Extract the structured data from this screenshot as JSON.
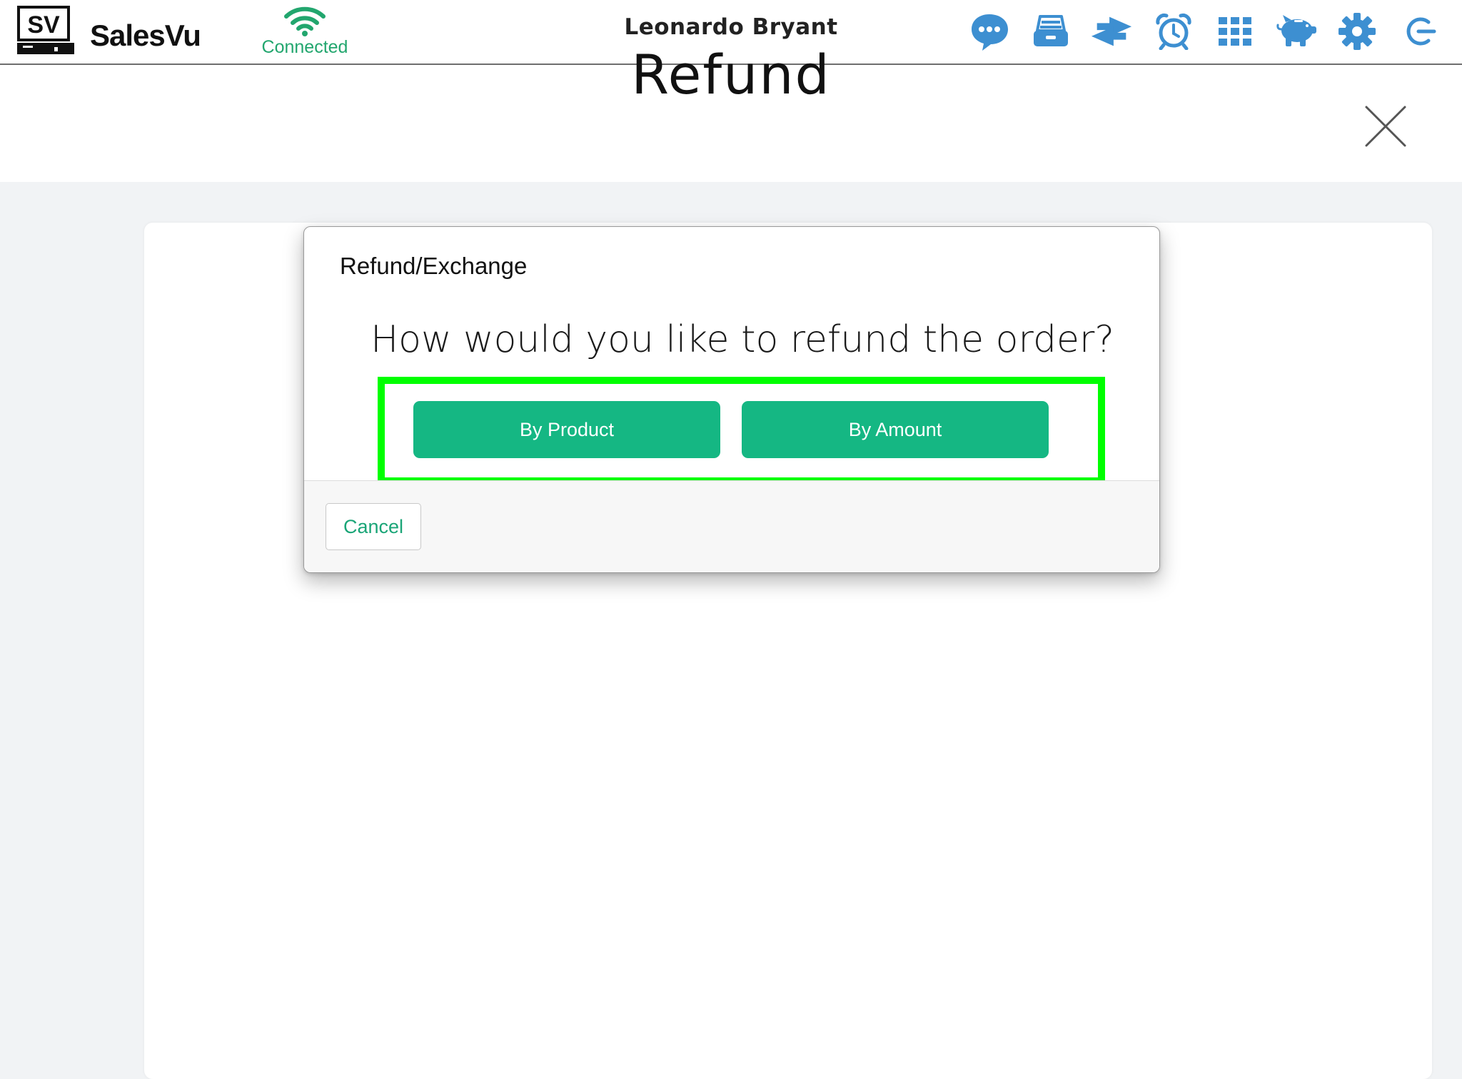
{
  "header": {
    "brand": "SalesVu",
    "logo_text": "SV",
    "connection_status": "Connected",
    "user_name": "Leonardo Bryant",
    "icons": [
      {
        "name": "chat-icon"
      },
      {
        "name": "cash-drawer-icon"
      },
      {
        "name": "transfer-icon"
      },
      {
        "name": "alarm-clock-icon"
      },
      {
        "name": "grid-icon"
      },
      {
        "name": "piggy-bank-icon"
      },
      {
        "name": "gear-icon"
      },
      {
        "name": "logout-icon"
      }
    ]
  },
  "page": {
    "title": "Refund"
  },
  "modal": {
    "header": "Refund/Exchange",
    "question": "How would you like to refund the order?",
    "by_product_label": "By Product",
    "by_amount_label": "By Amount",
    "cancel_label": "Cancel"
  },
  "colors": {
    "accent_green": "#15b783",
    "connected_green": "#22a66e",
    "icon_blue": "#3d8fd1",
    "highlight": "#00ff00"
  }
}
